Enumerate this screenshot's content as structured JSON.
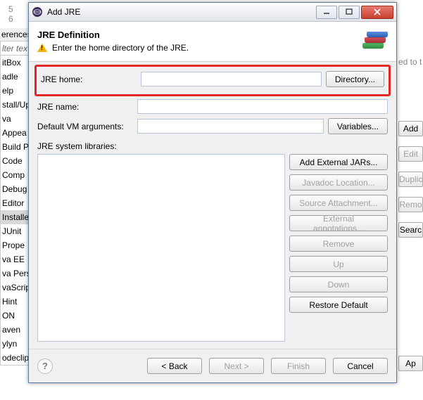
{
  "window": {
    "title": "Add JRE"
  },
  "banner": {
    "title": "JRE Definition",
    "message": "Enter the home directory of the JRE."
  },
  "form": {
    "jre_home_label": "JRE home:",
    "jre_home_value": "",
    "directory_btn": "Directory...",
    "jre_name_label": "JRE name:",
    "jre_name_value": "",
    "vm_args_label": "Default VM arguments:",
    "vm_args_value": "",
    "variables_btn": "Variables...",
    "sys_libs_label": "JRE system libraries:"
  },
  "lib_buttons": {
    "add_ext": "Add External JARs...",
    "javadoc": "Javadoc Location...",
    "src": "Source Attachment...",
    "ext_ann": "External annotations...",
    "remove": "Remove",
    "up": "Up",
    "down": "Down",
    "restore": "Restore Default"
  },
  "footer": {
    "back": "< Back",
    "next": "Next >",
    "finish": "Finish",
    "cancel": "Cancel"
  },
  "bg": {
    "erences": "erences",
    "filter": "lter tex",
    "left_items": [
      "itBox",
      "adle",
      "elp",
      "stall/Up",
      "va",
      "Appea",
      "Build P",
      "Code",
      "Comp",
      "Debug",
      "Editor",
      "Installe",
      "JUnit",
      "Prope",
      "va EE",
      "va Pers",
      "vaScrip",
      "Hint",
      "ON",
      "aven",
      "ylyn",
      "odeclips"
    ],
    "left_selected_index": 11,
    "right_text": "ed to t",
    "right_buttons": {
      "add": "Add",
      "edit": "Edit",
      "dup": "Duplic",
      "remove": "Remo",
      "search": "Searc",
      "apply": "Ap"
    }
  }
}
